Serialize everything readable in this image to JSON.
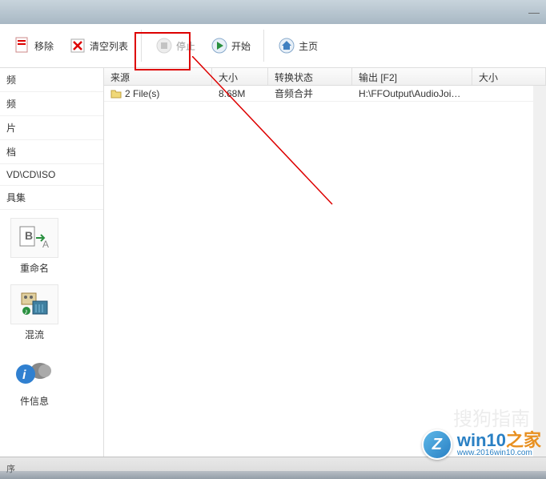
{
  "titlebar": {
    "minimize": "—"
  },
  "toolbar": {
    "remove_label": "移除",
    "clear_label": "清空列表",
    "stop_label": "停止",
    "start_label": "开始",
    "home_label": "主页"
  },
  "sidebar": {
    "items": [
      {
        "label": "频"
      },
      {
        "label": "频"
      },
      {
        "label": "片"
      },
      {
        "label": "档"
      },
      {
        "label": "VD\\CD\\ISO"
      },
      {
        "label": "具集"
      }
    ],
    "tools": [
      {
        "label": "重命名"
      },
      {
        "label": "混流"
      },
      {
        "label": "件信息"
      }
    ]
  },
  "table": {
    "headers": {
      "source": "来源",
      "size": "大小",
      "status": "转换状态",
      "output": "输出 [F2]",
      "size2": "大小"
    },
    "rows": [
      {
        "source": "2 File(s)",
        "size": "8.68M",
        "status": "音频合并",
        "output": "H:\\FFOutput\\AudioJoine..."
      }
    ]
  },
  "statusbar": {
    "text": "序"
  },
  "branding": {
    "watermark": "搜狗指南",
    "logo_letter": "Z",
    "logo_text_1": "win10",
    "logo_text_2": "之家",
    "logo_url": "www.2016win10.com"
  }
}
